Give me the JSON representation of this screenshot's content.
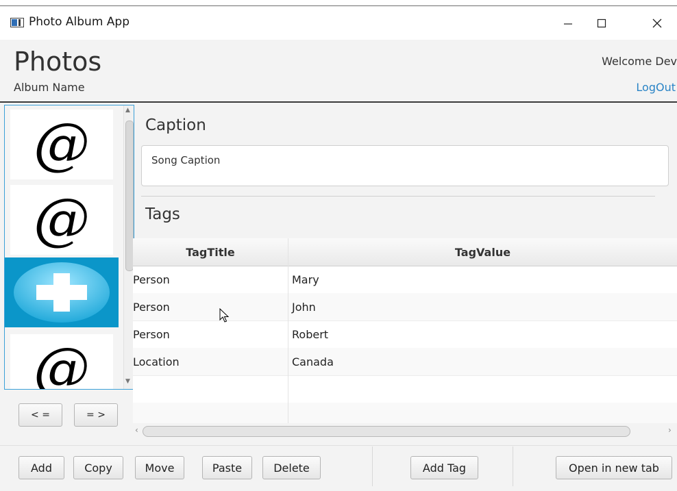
{
  "window": {
    "title": "Photo Album App"
  },
  "header": {
    "title": "Photos",
    "album_name": "Album Name",
    "welcome": "Welcome Dev",
    "logout": "LogOut"
  },
  "thumbnails": [
    {
      "symbol": "@",
      "selected": false
    },
    {
      "symbol": "@",
      "selected": false
    },
    {
      "symbol": "plus",
      "selected": true
    },
    {
      "symbol": "@",
      "selected": false
    }
  ],
  "nav": {
    "prev_label": "< =",
    "next_label": "= >"
  },
  "caption": {
    "heading": "Caption",
    "value": "Song Caption"
  },
  "tags": {
    "heading": "Tags",
    "columns": [
      "TagTitle",
      "TagValue"
    ],
    "rows": [
      {
        "title": "Person",
        "value": "Mary"
      },
      {
        "title": "Person",
        "value": "John"
      },
      {
        "title": "Person",
        "value": "Robert"
      },
      {
        "title": "Location",
        "value": "Canada"
      }
    ]
  },
  "toolbar": {
    "add_label": "Add",
    "copy_label": "Copy",
    "move_label": "Move",
    "paste_label": "Paste",
    "delete_label": "Delete",
    "add_tag_label": "Add Tag",
    "open_new_tab_label": "Open in new tab"
  },
  "colors": {
    "accent": "#2a84c6",
    "selection": "#0b96c9",
    "list_border": "#3aa0d8"
  }
}
